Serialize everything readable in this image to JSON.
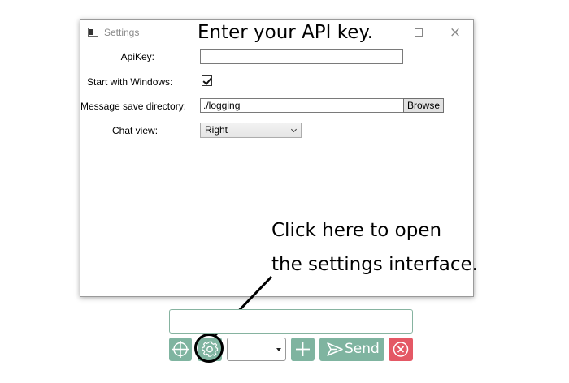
{
  "window": {
    "title": "Settings",
    "app_icon": "window-icon",
    "controls": {
      "minimize": "minimize-icon",
      "maximize": "maximize-icon",
      "close": "×"
    }
  },
  "settings": {
    "apikey_label": "ApiKey:",
    "apikey_value": "",
    "start_with_windows_label": "Start with Windows:",
    "start_with_windows_checked": true,
    "save_dir_label": "Message save directory:",
    "save_dir_value": "./logging",
    "browse_label": "Browse",
    "chat_view_label": "Chat view:",
    "chat_view_value": "Right"
  },
  "annotations": {
    "api_key_hint": "Enter your API key.",
    "settings_hint_line1": "Click here to open",
    "settings_hint_line2": "the settings interface."
  },
  "toolbar": {
    "message_input_value": "",
    "crosshair_icon": "crosshair-icon",
    "settings_icon": "gear-icon",
    "dropdown_value": "",
    "add_icon": "plus-icon",
    "send_label": "Send",
    "send_icon": "send-icon",
    "cancel_icon": "cancel-icon"
  },
  "colors": {
    "button_green": "#7fb4a0",
    "cancel_red": "#e45865",
    "input_border": "#86b3a0"
  }
}
